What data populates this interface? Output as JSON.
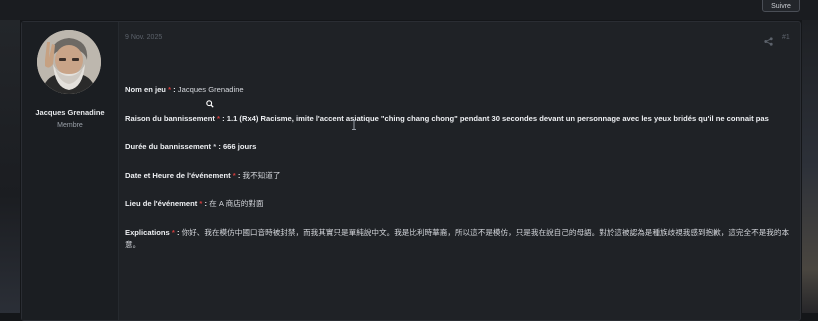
{
  "toolbar": {
    "follow_label": "Suivre"
  },
  "post": {
    "date": "9 Nov. 2025",
    "number": "#1",
    "author": {
      "name": "Jacques Grenadine",
      "role": "Membre"
    },
    "fields": {
      "player": {
        "label": "Nom en jeu",
        "req": "*",
        "sep": " : ",
        "value": "Jacques Grenadine"
      },
      "reason": {
        "label": "Raison du bannissement",
        "req": "*",
        "sep": " :",
        "value": "1.1 (Rx4) Racisme, imite l'accent asiatique \"ching chang chong\" pendant 30 secondes devant un personnage avec les yeux bridés qu'il ne connait pas"
      },
      "duration": {
        "label": "Durée du bannissement",
        "req": "*",
        "sep": " : ",
        "value": "666 jours"
      },
      "datetime": {
        "label": "Date et Heure de l'événement",
        "req": "*",
        "sep": " : ",
        "value": "我不知道了"
      },
      "location": {
        "label": "Lieu de l'événement",
        "req": "*",
        "sep": " : ",
        "value": "在 A 商店的對面"
      },
      "explanations": {
        "label": "Explications",
        "req": "*",
        "sep": " : ",
        "value": "你好、我在模仿中國口音時被封禁，而我其實只是單純說中文。我是比利時華裔，所以這不是模仿，只是我在說自己的母語。對於這被認為是種族歧視我感到抱歉，這完全不是我的本意。"
      }
    }
  },
  "colors": {
    "required": "#d23c3c",
    "background": "#141619",
    "panel": "#1f2226"
  },
  "icons": {
    "share": "share-icon",
    "cursor": "cursor-icon",
    "text_cursor": "text-cursor-icon"
  }
}
